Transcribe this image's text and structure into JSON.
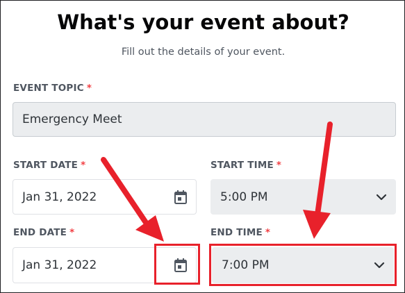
{
  "header": {
    "title": "What's your event about?",
    "subtitle": "Fill out the details of your event."
  },
  "form": {
    "topic": {
      "label": "EVENT TOPIC",
      "value": "Emergency Meet"
    },
    "start_date": {
      "label": "START DATE",
      "value": "Jan 31, 2022"
    },
    "start_time": {
      "label": "START TIME",
      "value": "5:00 PM"
    },
    "end_date": {
      "label": "END DATE",
      "value": "Jan 31, 2022"
    },
    "end_time": {
      "label": "END TIME",
      "value": "7:00 PM"
    },
    "required_marker": "*"
  },
  "icons": {
    "date_picker": "calendar-icon",
    "dropdown": "chevron-down-icon",
    "annotation": "red-arrow"
  },
  "colors": {
    "required": "#f23f43",
    "annotation": "#e8212b",
    "field_bg": "#ebedef"
  }
}
